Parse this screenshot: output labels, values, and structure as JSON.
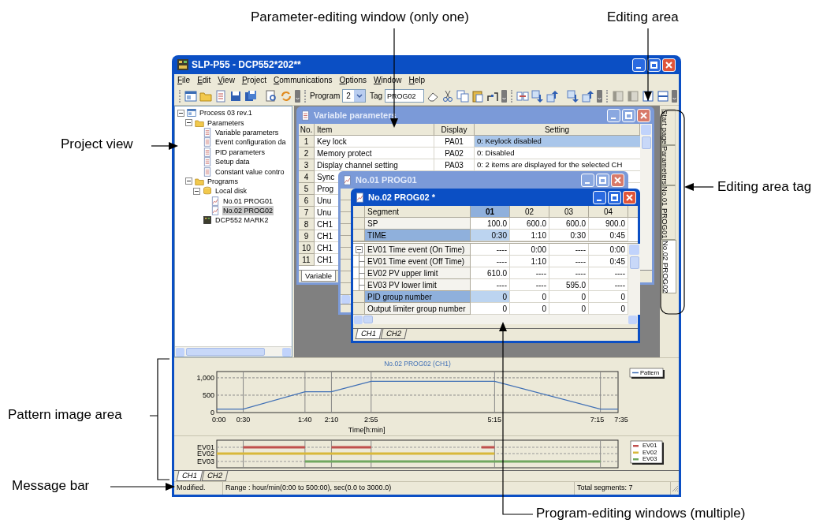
{
  "annotations": [
    {
      "text": "Parameter-editing window (only one)"
    },
    {
      "text": "Editing area"
    },
    {
      "text": "Project view"
    },
    {
      "text": "Editing area tag"
    },
    {
      "text": "Pattern image area"
    },
    {
      "text": "Message bar"
    },
    {
      "text": "Program-editing windows (multiple)"
    }
  ],
  "window": {
    "title": "SLP-P55 - DCP552*202**"
  },
  "menu": [
    "File",
    "Edit",
    "View",
    "Project",
    "Communications",
    "Options",
    "Window",
    "Help"
  ],
  "toolbar": {
    "program_label": "Program",
    "program_value": "2",
    "tag_label": "Tag",
    "tag_value": "PROG02"
  },
  "project_tree": [
    {
      "label": "Process 03 rev.1",
      "kind": "project",
      "expanded": true,
      "selected": false,
      "children": [
        {
          "label": "Parameters",
          "kind": "folder",
          "expanded": true,
          "selected": false,
          "children": [
            {
              "label": "Variable parameters",
              "kind": "document",
              "selected": false
            },
            {
              "label": "Event configuration da",
              "kind": "document",
              "selected": false
            },
            {
              "label": "PID parameters",
              "kind": "document",
              "selected": false
            },
            {
              "label": "Setup data",
              "kind": "document",
              "selected": false
            },
            {
              "label": "Constant value contro",
              "kind": "document",
              "selected": false
            }
          ]
        },
        {
          "label": "Programs",
          "kind": "folder",
          "expanded": true,
          "selected": false,
          "children": [
            {
              "label": "Local disk",
              "kind": "disk",
              "expanded": true,
              "selected": false,
              "children": [
                {
                  "label": "No.01 PROG01",
                  "kind": "program",
                  "selected": false
                },
                {
                  "label": "No.02 PROG02",
                  "kind": "program",
                  "selected": true
                }
              ]
            },
            {
              "label": "DCP552 MARK2",
              "kind": "device",
              "selected": false
            }
          ]
        }
      ]
    }
  ],
  "variable_parameters": {
    "title": "Variable parameters",
    "active": false,
    "columns": [
      "No.",
      "Item",
      "Display",
      "Setting"
    ],
    "rows": [
      {
        "no": "1",
        "item": "Key lock",
        "display": "PA01",
        "setting": "0: Keylock disabled",
        "selected": true
      },
      {
        "no": "2",
        "item": "Memory protect",
        "display": "PA02",
        "setting": "0: Disabled",
        "selected": false
      },
      {
        "no": "3",
        "item": "Display channel setting",
        "display": "PA03",
        "setting": "0: 2 items are displayed for the selected CH",
        "selected": false
      },
      {
        "no": "4",
        "item": "Sync"
      },
      {
        "no": "5",
        "item": "Prog"
      },
      {
        "no": "6",
        "item": "Unu"
      },
      {
        "no": "7",
        "item": "Unu"
      },
      {
        "no": "8",
        "item": "CH1"
      },
      {
        "no": "9",
        "item": "CH1"
      },
      {
        "no": "10",
        "item": "CH1"
      },
      {
        "no": "11",
        "item": "CH1"
      }
    ],
    "tab": "Variable"
  },
  "program_01": {
    "title": "No.01 PROG01",
    "active": false
  },
  "program_02": {
    "title": "No.02 PROG02 *",
    "active": true,
    "columns": [
      {
        "label": "Segment",
        "selected": false
      },
      {
        "label": "01",
        "selected": true
      },
      {
        "label": "02",
        "selected": false
      },
      {
        "label": "03",
        "selected": false
      },
      {
        "label": "04",
        "selected": false
      }
    ],
    "rows": [
      {
        "label": "SP",
        "kind": "main",
        "selected": false,
        "values": [
          "100.0",
          "600.0",
          "600.0",
          "900.0"
        ]
      },
      {
        "label": "TIME",
        "kind": "main",
        "selected": true,
        "values": [
          "0:30",
          "1:10",
          "0:30",
          "0:45"
        ]
      },
      {
        "label": "EV01 Time event (On Time)",
        "kind": "event",
        "selected": false,
        "values": [
          "----",
          "0:00",
          "----",
          "0:00"
        ]
      },
      {
        "label": "EV01 Time event (Off Time)",
        "kind": "event",
        "selected": false,
        "values": [
          "----",
          "1:10",
          "----",
          "0:45"
        ]
      },
      {
        "label": "EV02 PV upper limit",
        "kind": "event",
        "selected": false,
        "values": [
          "610.0",
          "----",
          "----",
          "----"
        ]
      },
      {
        "label": "EV03 PV lower limit",
        "kind": "event",
        "selected": false,
        "values": [
          "----",
          "----",
          "595.0",
          "----"
        ]
      },
      {
        "label": "PID group number",
        "kind": "main",
        "selected": true,
        "values": [
          "0",
          "0",
          "0",
          "0"
        ]
      },
      {
        "label": "Output limiter group number",
        "kind": "main",
        "selected": false,
        "values": [
          "0",
          "0",
          "0",
          "0"
        ]
      }
    ],
    "tabs": [
      {
        "label": "CH1",
        "selected": true
      },
      {
        "label": "CH2",
        "selected": false
      }
    ]
  },
  "editing_tabs": [
    {
      "label": "Start page",
      "selected": false
    },
    {
      "label": "Parameters",
      "selected": false
    },
    {
      "label": "No.01 PROG01",
      "selected": false
    },
    {
      "label": "No.02 PROG02",
      "selected": true
    }
  ],
  "pattern": {
    "chart_data": {
      "type": "line",
      "title": "No.02 PROG02 (CH1)",
      "xlabel": "Time[h:min]",
      "xlim": [
        0,
        455
      ],
      "ylim": [
        0,
        1180
      ],
      "grid": true,
      "x": [
        0,
        30,
        100,
        130,
        175,
        315,
        435,
        455
      ],
      "series": [
        {
          "name": "Pattern",
          "color": "#3f6fb5",
          "values": [
            100,
            100,
            600,
            600,
            900,
            900,
            100,
            100
          ]
        }
      ],
      "xticks": [
        {
          "value": 0,
          "label": "0:00"
        },
        {
          "value": 30,
          "label": "0:30"
        },
        {
          "value": 100,
          "label": "1:40"
        },
        {
          "value": 130,
          "label": "2:10"
        },
        {
          "value": 175,
          "label": "2:55"
        },
        {
          "value": 315,
          "label": "5:15"
        },
        {
          "value": 435,
          "label": "7:15"
        },
        {
          "value": 455,
          "label": "7:35"
        }
      ],
      "yticks": [
        {
          "value": 0,
          "label": "0"
        },
        {
          "value": 500,
          "label": "500"
        },
        {
          "value": 1000,
          "label": "1,000"
        }
      ]
    }
  },
  "events": {
    "lanes": [
      {
        "name": "EV01",
        "legend": "EV01",
        "color": "#c0504d"
      },
      {
        "name": "EV02",
        "legend": "EV02",
        "color": "#d8b83a"
      },
      {
        "name": "EV03",
        "legend": "EV03",
        "color": "#70a860"
      }
    ]
  },
  "bottom_tabs": [
    {
      "label": "CH1",
      "selected": true
    },
    {
      "label": "CH2",
      "selected": false
    }
  ],
  "status_bar": [
    "Modified.",
    "Range : hour/min(0:00 to 500:00), sec(0.0 to 3000.0)",
    "Total segments: 7"
  ]
}
